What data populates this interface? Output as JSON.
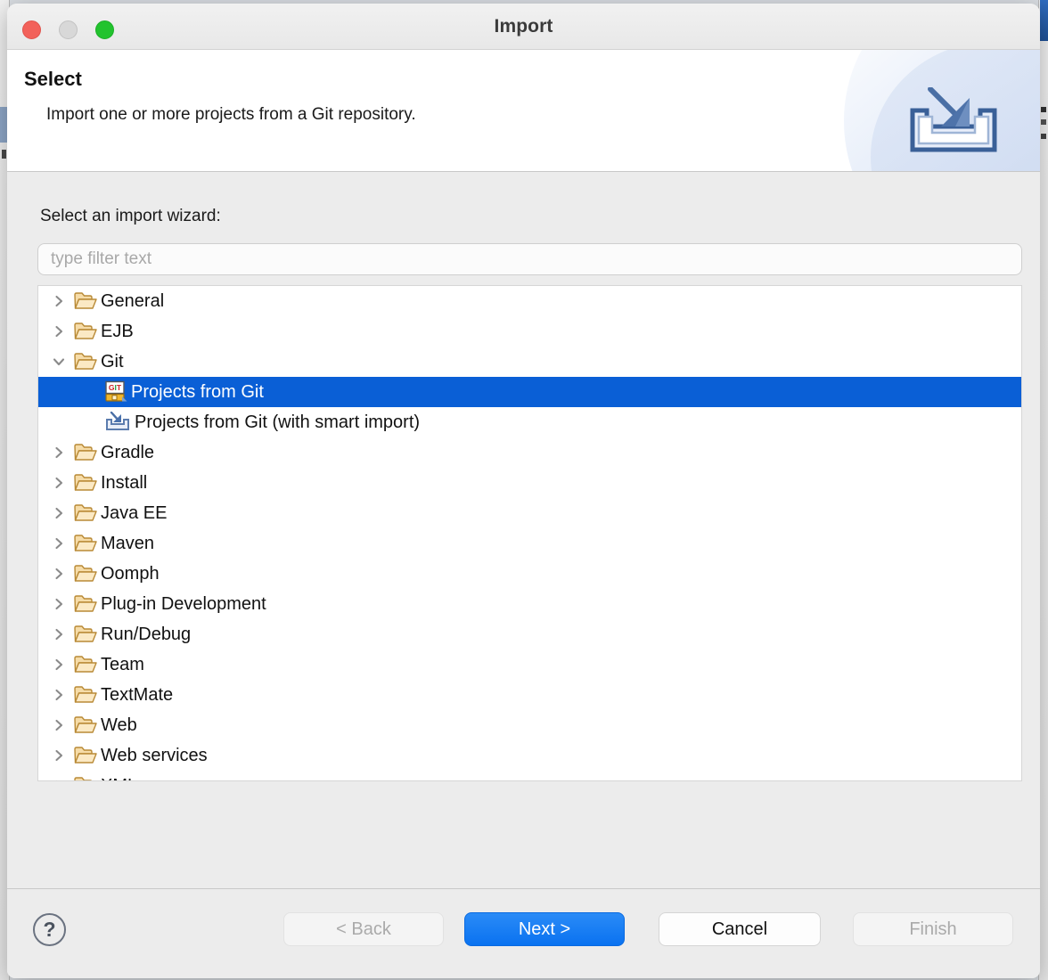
{
  "window": {
    "title": "Import",
    "controls": {
      "close": "close-button",
      "minimize": "minimize-button",
      "zoom": "zoom-button"
    }
  },
  "header": {
    "title": "Select",
    "description": "Import one or more projects from a Git repository.",
    "icon": "import-wizard-banner-icon"
  },
  "main": {
    "prompt": "Select an import wizard:",
    "filter": {
      "value": "",
      "placeholder": "type filter text"
    },
    "tree": [
      {
        "label": "General",
        "icon": "folder-icon",
        "expanded": false,
        "level": 0,
        "selected": false
      },
      {
        "label": "EJB",
        "icon": "folder-icon",
        "expanded": false,
        "level": 0,
        "selected": false
      },
      {
        "label": "Git",
        "icon": "folder-icon",
        "expanded": true,
        "level": 0,
        "selected": false
      },
      {
        "label": "Projects from Git",
        "icon": "git-icon",
        "level": 1,
        "selected": true
      },
      {
        "label": "Projects from Git (with smart import)",
        "icon": "smart-import-icon",
        "level": 1,
        "selected": false
      },
      {
        "label": "Gradle",
        "icon": "folder-icon",
        "expanded": false,
        "level": 0,
        "selected": false
      },
      {
        "label": "Install",
        "icon": "folder-icon",
        "expanded": false,
        "level": 0,
        "selected": false
      },
      {
        "label": "Java EE",
        "icon": "folder-icon",
        "expanded": false,
        "level": 0,
        "selected": false
      },
      {
        "label": "Maven",
        "icon": "folder-icon",
        "expanded": false,
        "level": 0,
        "selected": false
      },
      {
        "label": "Oomph",
        "icon": "folder-icon",
        "expanded": false,
        "level": 0,
        "selected": false
      },
      {
        "label": "Plug-in Development",
        "icon": "folder-icon",
        "expanded": false,
        "level": 0,
        "selected": false
      },
      {
        "label": "Run/Debug",
        "icon": "folder-icon",
        "expanded": false,
        "level": 0,
        "selected": false
      },
      {
        "label": "Team",
        "icon": "folder-icon",
        "expanded": false,
        "level": 0,
        "selected": false
      },
      {
        "label": "TextMate",
        "icon": "folder-icon",
        "expanded": false,
        "level": 0,
        "selected": false
      },
      {
        "label": "Web",
        "icon": "folder-icon",
        "expanded": false,
        "level": 0,
        "selected": false
      },
      {
        "label": "Web services",
        "icon": "folder-icon",
        "expanded": false,
        "level": 0,
        "selected": false
      },
      {
        "label": "XML",
        "icon": "folder-icon",
        "expanded": false,
        "level": 0,
        "selected": false
      }
    ]
  },
  "footer": {
    "help_label": "?",
    "back_label": "< Back",
    "next_label": "Next >",
    "cancel_label": "Cancel",
    "finish_label": "Finish",
    "back_enabled": false,
    "next_enabled": true,
    "cancel_enabled": true,
    "finish_enabled": false
  },
  "colors": {
    "selection_blue": "#0a5fd6",
    "primary_button_blue": "#0a72f0",
    "window_chrome": "#ececec",
    "banner_background": "#ffffff",
    "folder_icon": "#f2d193"
  }
}
